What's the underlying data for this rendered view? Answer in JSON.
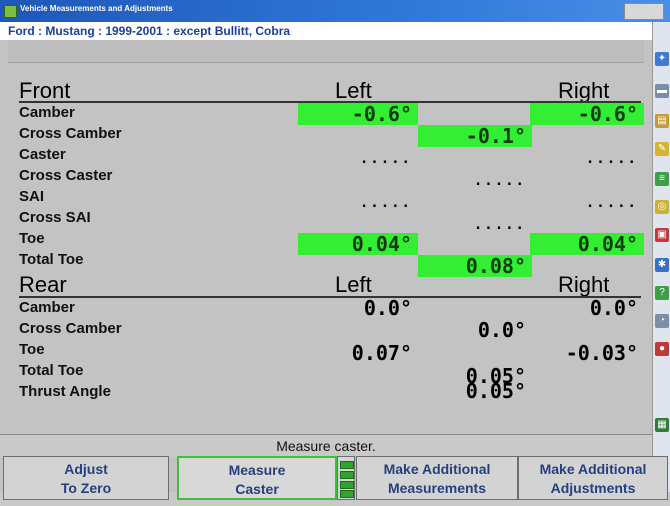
{
  "window": {
    "title": "Vehicle Measurements and Adjustments"
  },
  "vehicle": "Ford : Mustang : 1999-2001 : except Bullitt, Cobra",
  "front": {
    "heading": "Front",
    "left_label": "Left",
    "right_label": "Right",
    "rows": [
      {
        "label": "Camber",
        "left": "-0.6°",
        "right": "-0.6°"
      },
      {
        "label": "Cross Camber",
        "center": "-0.1°"
      },
      {
        "label": "Caster",
        "left": ".....",
        "right": "....."
      },
      {
        "label": "Cross Caster",
        "center": "....."
      },
      {
        "label": "SAI",
        "left": ".....",
        "right": "....."
      },
      {
        "label": "Cross SAI",
        "center": "....."
      },
      {
        "label": "Toe",
        "left": "0.04°",
        "right": "0.04°"
      },
      {
        "label": "Total Toe",
        "center": "0.08°"
      }
    ]
  },
  "rear": {
    "heading": "Rear",
    "left_label": "Left",
    "right_label": "Right",
    "rows": [
      {
        "label": "Camber",
        "left": "0.0°",
        "right": "0.0°"
      },
      {
        "label": "Cross Camber",
        "center": "0.0°"
      },
      {
        "label": "Toe",
        "left": "0.07°",
        "right": "-0.03°"
      },
      {
        "label": "Total Toe",
        "center": "0.05°"
      },
      {
        "label": "Thrust Angle",
        "center": "0.05°"
      }
    ]
  },
  "status": "Measure caster.",
  "buttons": {
    "adjust_zero": {
      "line1": "Adjust",
      "line2": "To Zero"
    },
    "measure_caster": {
      "line1": "Measure",
      "line2": "Caster"
    },
    "make_measurements": {
      "line1": "Make Additional",
      "line2": "Measurements"
    },
    "make_adjustments": {
      "line1": "Make Additional",
      "line2": "Adjustments"
    }
  },
  "colors": {
    "in_spec": "#33ee33",
    "title_bar": "#2f78d8",
    "button_text": "#24417d"
  },
  "sidebar_icons": [
    "alignment-icon",
    "vehicle-icon",
    "specs-icon",
    "tools-icon",
    "chart-icon",
    "wheel-icon",
    "print-icon",
    "settings-icon",
    "help-icon",
    "gauge-icon",
    "camera-icon",
    "report-icon"
  ]
}
